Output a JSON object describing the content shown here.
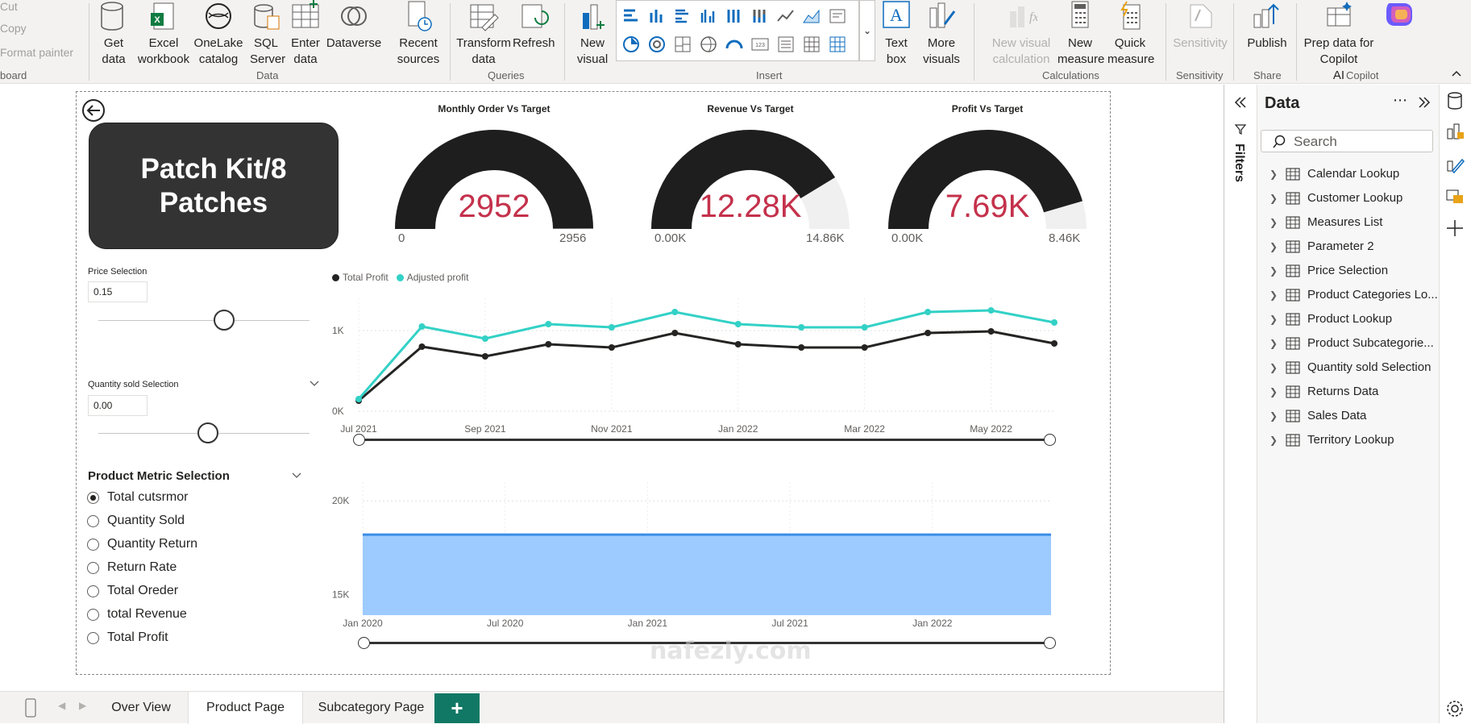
{
  "ribbon": {
    "clipboard": {
      "cut": "Cut",
      "copy": "Copy",
      "format_painter": "Format painter",
      "group": "board"
    },
    "data_group": {
      "label": "Data",
      "get_data": "Get\ndata",
      "excel": "Excel\nworkbook",
      "onelake": "OneLake\ncatalog",
      "sql": "SQL\nServer",
      "enter_data": "Enter\ndata",
      "dataverse": "Dataverse",
      "recent": "Recent\nsources"
    },
    "queries_group": {
      "label": "Queries",
      "transform": "Transform\ndata",
      "refresh": "Refresh"
    },
    "insert_group": {
      "label": "Insert",
      "new_visual": "New\nvisual",
      "text_box": "Text\nbox",
      "more_visuals": "More\nvisuals"
    },
    "calc_group": {
      "label": "Calculations",
      "new_visual_calc": "New visual\ncalculation",
      "new_measure": "New\nmeasure",
      "quick_measure": "Quick\nmeasure"
    },
    "sens_group": {
      "label": "Sensitivity",
      "sensitivity": "Sensitivity"
    },
    "share_group": {
      "label": "Share",
      "publish": "Publish"
    },
    "copilot_group": {
      "label": "Copilot",
      "prep": "Prep data for Copilot\nAI"
    }
  },
  "report": {
    "title_card": "Patch Kit/8\nPatches",
    "gauges": [
      {
        "title": "Monthly Order Vs Target",
        "value": "2952",
        "min": "0",
        "max": "2956",
        "fill_fraction": 0.9986
      },
      {
        "title": "Revenue Vs Target",
        "value": "12.28K",
        "min": "0.00K",
        "max": "14.86K",
        "fill_fraction": 0.826
      },
      {
        "title": "Profit Vs Target",
        "value": "7.69K",
        "min": "0.00K",
        "max": "8.46K",
        "fill_fraction": 0.909
      }
    ],
    "price_slicer": {
      "title": "Price Selection",
      "value": "0.15",
      "position": 0.5
    },
    "qty_slicer": {
      "title": "Quantity sold Selection",
      "value": "0.00",
      "position": 0.5
    },
    "metric_slicer": {
      "title": "Product Metric Selection",
      "options": [
        "Total cutsrmor",
        "Quantity Sold",
        "Quantity Return",
        "Return Rate",
        "Total Oreder",
        "total Revenue",
        "Total Profit"
      ],
      "selected": 0
    }
  },
  "chart_data": [
    {
      "type": "line",
      "x": [
        "Jul 2021",
        "Aug 2021",
        "Sep 2021",
        "Oct 2021",
        "Nov 2021",
        "Dec 2021",
        "Jan 2022",
        "Feb 2022",
        "Mar 2022",
        "Apr 2022",
        "May 2022",
        "Jun 2022"
      ],
      "x_tick_labels": [
        "Jul 2021",
        "Sep 2021",
        "Nov 2021",
        "Jan 2022",
        "Mar 2022",
        "May 2022"
      ],
      "y_tick_labels": [
        "0K",
        "1K"
      ],
      "ylim": [
        0,
        1400
      ],
      "series": [
        {
          "name": "Total Profit",
          "values": [
            130,
            800,
            680,
            830,
            790,
            970,
            830,
            790,
            790,
            970,
            990,
            840
          ],
          "color": "#252423"
        },
        {
          "name": "Adjusted profit",
          "values": [
            150,
            1050,
            900,
            1080,
            1040,
            1230,
            1080,
            1040,
            1040,
            1230,
            1250,
            1100
          ],
          "color": "#33d1c6"
        }
      ],
      "legend": "top-left"
    },
    {
      "type": "area",
      "x": [
        "Jan 2020",
        "Jun 2022"
      ],
      "x_tick_labels": [
        "Jan 2020",
        "Jul 2020",
        "Jan 2021",
        "Jul 2021",
        "Jan 2022"
      ],
      "y_tick_labels": [
        "15K",
        "20K"
      ],
      "ylim": [
        13900,
        21000
      ],
      "series": [
        {
          "values": [
            18200,
            18200
          ],
          "color": "#9dcbff",
          "line_color": "#3a8ee6"
        }
      ]
    }
  ],
  "tabs": {
    "items": [
      "Over View",
      "Product Page",
      "Subcategory Page"
    ],
    "active": 1,
    "add": "+"
  },
  "filters_pane": {
    "label": "Filters"
  },
  "data_pane": {
    "title": "Data",
    "search_placeholder": "Search",
    "tables": [
      "Calendar Lookup",
      "Customer Lookup",
      "Measures List",
      "Parameter 2",
      "Price Selection",
      "Product Categories Lo...",
      "Product Lookup",
      "Product Subcategorie...",
      "Quantity sold Selection",
      "Returns Data",
      "Sales Data",
      "Territory Lookup"
    ]
  },
  "watermark": "nafezly.com"
}
